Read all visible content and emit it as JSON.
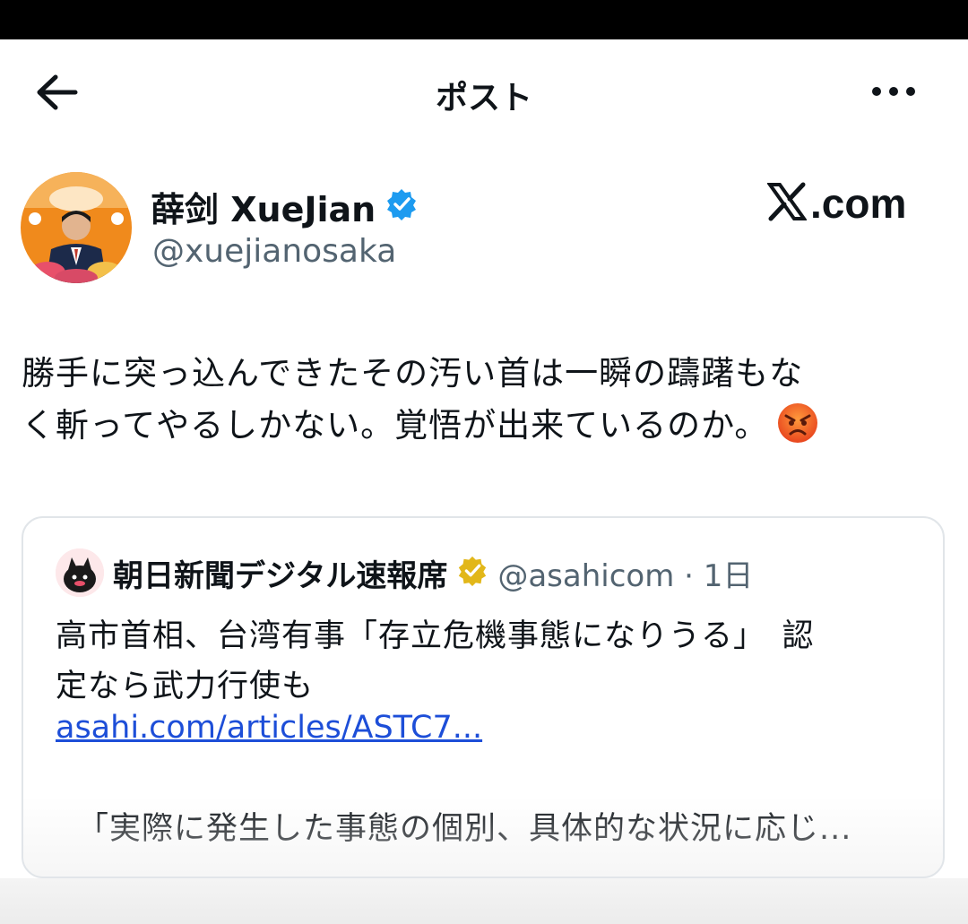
{
  "header": {
    "title": "ポスト"
  },
  "author": {
    "name": "薛剑 XueJian",
    "handle": "@xuejianosaka",
    "verified": true
  },
  "brand": {
    "text": ".com",
    "logo": "x-logo"
  },
  "post": {
    "line1": "勝手に突っ込んできたその汚い首は一瞬の躊躇もな",
    "line2": "く斬ってやるしかない。覚悟が出来ているのか。",
    "emoji": "angry-face"
  },
  "quote": {
    "name": "朝日新聞デジタル速報席",
    "verified": "gold",
    "handle_time": "@asahicom · 1日",
    "line1": "高市首相、台湾有事「存立危機事態になりうる」　認",
    "line2": "定なら武力行使も",
    "link": "asahi.com/articles/ASTC7...",
    "excerpt": "「実際に発生した事態の個別、具体的な状況に応じ..."
  },
  "colors": {
    "text": "#0f1419",
    "secondary": "#536471",
    "verified_blue": "#1d9bf0",
    "verified_gold": "#e2b719",
    "link": "#1d4ed8"
  }
}
